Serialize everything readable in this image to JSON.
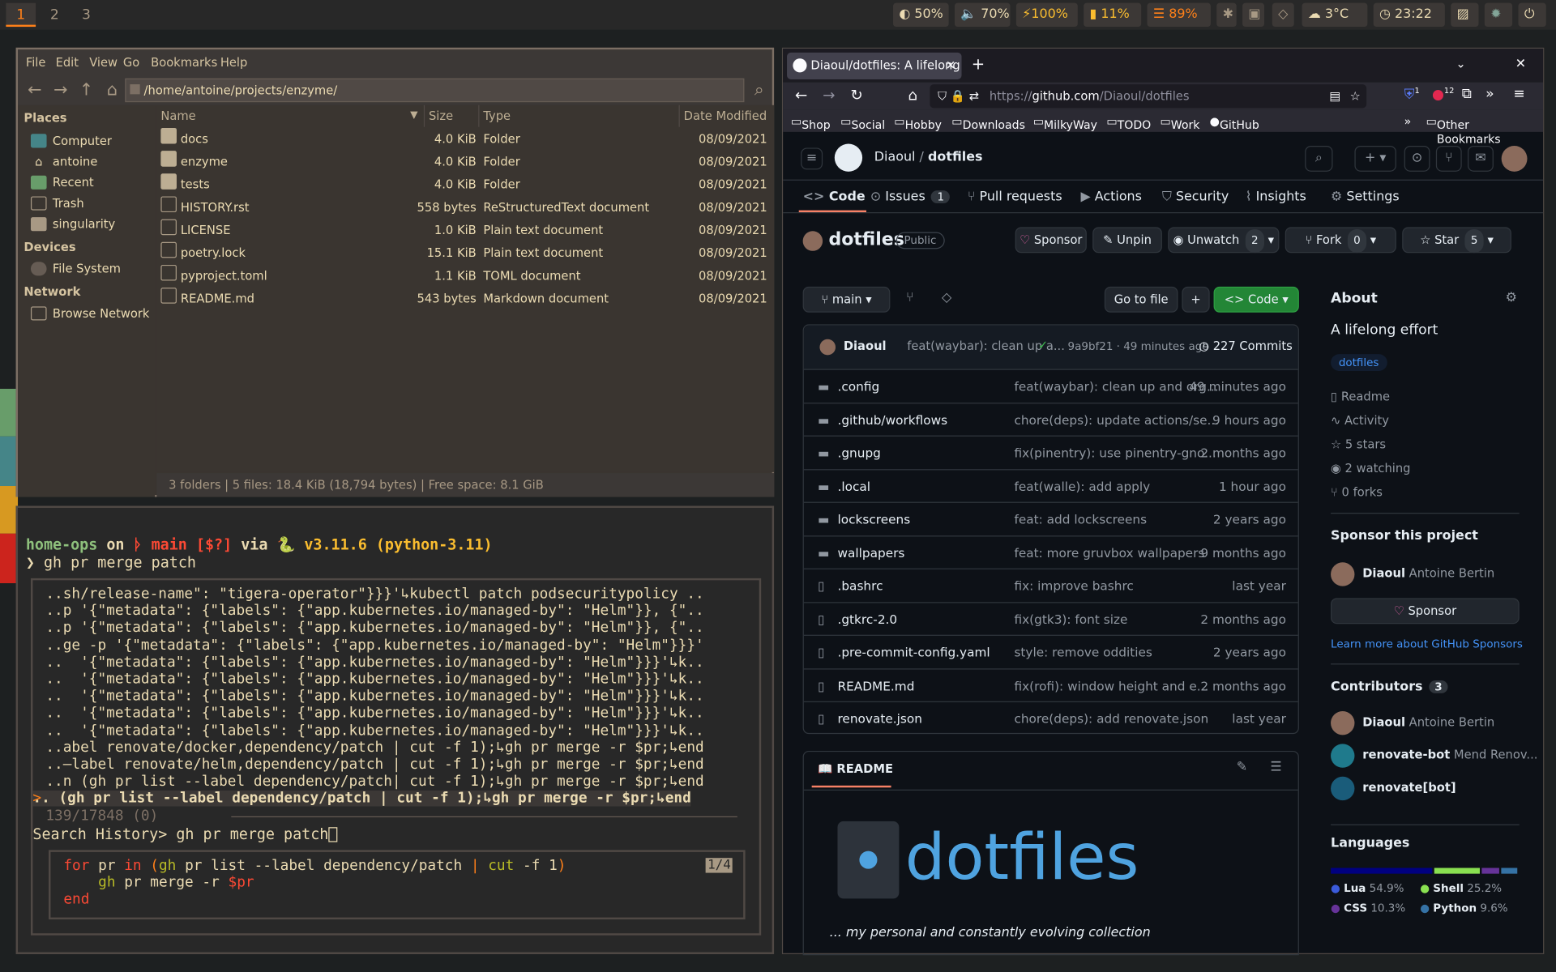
{
  "topbar": {
    "workspaces": [
      "1",
      "2",
      "3"
    ],
    "brightness": "◐ 50%",
    "volume": "🔈 70%",
    "power": "⚡100%",
    "battery": "▮ 11%",
    "memory": "☰ 89%",
    "weather": "3°C",
    "clock": "◷ 23:22"
  },
  "fm": {
    "menu": [
      "File",
      "Edit",
      "View",
      "Go",
      "Bookmarks",
      "Help"
    ],
    "path": "/home/antoine/projects/enzyme/",
    "places_header": "Places",
    "places": [
      "Computer",
      "antoine",
      "Recent",
      "Trash",
      "singularity"
    ],
    "devices_header": "Devices",
    "devices": [
      "File System"
    ],
    "network_header": "Network",
    "network": [
      "Browse Network"
    ],
    "columns": [
      "Name",
      "Size",
      "Type",
      "Date Modified"
    ],
    "rows": [
      {
        "name": "docs",
        "size": "4.0 KiB",
        "type": "Folder",
        "date": "08/09/2021"
      },
      {
        "name": "enzyme",
        "size": "4.0 KiB",
        "type": "Folder",
        "date": "08/09/2021"
      },
      {
        "name": "tests",
        "size": "4.0 KiB",
        "type": "Folder",
        "date": "08/09/2021"
      },
      {
        "name": "HISTORY.rst",
        "size": "558 bytes",
        "type": "ReStructuredText document",
        "date": "08/09/2021"
      },
      {
        "name": "LICENSE",
        "size": "1.0 KiB",
        "type": "Plain text document",
        "date": "08/09/2021"
      },
      {
        "name": "poetry.lock",
        "size": "15.1 KiB",
        "type": "Plain text document",
        "date": "08/09/2021"
      },
      {
        "name": "pyproject.toml",
        "size": "1.1 KiB",
        "type": "TOML document",
        "date": "08/09/2021"
      },
      {
        "name": "README.md",
        "size": "543 bytes",
        "type": "Markdown document",
        "date": "08/09/2021"
      }
    ],
    "status": "3 folders  |  5 files: 18.4 KiB (18,794 bytes)  |  Free space: 8.1 GiB"
  },
  "term": {
    "prompt_dir": "home-ops",
    "prompt_on": " on ",
    "prompt_branch": "ᚦ main [$?]",
    "prompt_via": " via ",
    "prompt_py": "🐍 v3.11.6 (python-3.11)",
    "command": "❯ gh pr merge patch",
    "history": [
      "..sh/release-name\": \"tigera-operator\"}}}'↳kubectl patch podsecuritypolicy ..",
      "..p '{\"metadata\": {\"labels\": {\"app.kubernetes.io/managed-by\": \"Helm\"}}, {\"..",
      "..p '{\"metadata\": {\"labels\": {\"app.kubernetes.io/managed-by\": \"Helm\"}}, {\"..",
      "..ge -p '{\"metadata\": {\"labels\": {\"app.kubernetes.io/managed-by\": \"Helm\"}}}'",
      "..  '{\"metadata\": {\"labels\": {\"app.kubernetes.io/managed-by\": \"Helm\"}}}'↳k..",
      "..  '{\"metadata\": {\"labels\": {\"app.kubernetes.io/managed-by\": \"Helm\"}}}'↳k..",
      "..  '{\"metadata\": {\"labels\": {\"app.kubernetes.io/managed-by\": \"Helm\"}}}'↳k..",
      "..  '{\"metadata\": {\"labels\": {\"app.kubernetes.io/managed-by\": \"Helm\"}}}'↳k..",
      "..  '{\"metadata\": {\"labels\": {\"app.kubernetes.io/managed-by\": \"Helm\"}}}'↳k..",
      "..abel renovate/docker,dependency/patch | cut -f 1);↳gh pr merge -r $pr;↳end",
      "..—label renovate/helm,dependency/patch | cut -f 1);↳gh pr merge -r $pr;↳end",
      "..n (gh pr list --label dependency/patch| cut -f 1);↳gh pr merge -r $pr;↳end",
      ".. (gh pr list --label dependency/patch | cut -f 1);↳gh pr merge -r $pr;↳end"
    ],
    "count": "139/17848 (0)",
    "search_label": "Search History> ",
    "search_query": "gh pr merge patch",
    "preview_lines": [
      "for pr in (gh pr list --label dependency/patch | cut -f 1)",
      "    gh pr merge -r $pr",
      "end"
    ],
    "preview_page": "1/4"
  },
  "browser": {
    "tab_title": "Diaoul/dotfiles: A lifelong e",
    "url_prefix": "https://",
    "url_host": "github.com",
    "url_path": "/Diaoul/dotfiles",
    "bookmarks": [
      "Shop",
      "Social",
      "Hobby",
      "Downloads",
      "MilkyWay",
      "TODO",
      "Work",
      "GitHub"
    ],
    "other_bookmarks": "Other Bookmarks",
    "badge1": "1",
    "badge2": "12"
  },
  "gh": {
    "owner": "Diaoul",
    "sep": "/",
    "repo": "dotfiles",
    "tabs": [
      {
        "label": "Code",
        "count": ""
      },
      {
        "label": "Issues",
        "count": "1"
      },
      {
        "label": "Pull requests",
        "count": ""
      },
      {
        "label": "Actions",
        "count": ""
      },
      {
        "label": "Security",
        "count": ""
      },
      {
        "label": "Insights",
        "count": ""
      },
      {
        "label": "Settings",
        "count": ""
      }
    ],
    "visibility": "Public",
    "sponsor": "Sponsor",
    "unpin": "Unpin",
    "unwatch": "Unwatch",
    "watch_count": "2",
    "fork": "Fork",
    "fork_count": "0",
    "star": "Star",
    "star_count": "5",
    "branch": "main",
    "go_to_file": "Go to file",
    "code_btn": "Code",
    "commit_author": "Diaoul",
    "commit_msg": "feat(waybar): clean up a...",
    "commit_hash": "9a9bf21 · 49 minutes ago",
    "commits": "227 Commits",
    "files": [
      {
        "name": ".config",
        "msg": "feat(waybar): clean up and org...",
        "age": "49 minutes ago",
        "dir": true
      },
      {
        "name": ".github/workflows",
        "msg": "chore(deps): update actions/se...",
        "age": "9 hours ago",
        "dir": true
      },
      {
        "name": ".gnupg",
        "msg": "fix(pinentry): use pinentry-gno...",
        "age": "2 months ago",
        "dir": true
      },
      {
        "name": ".local",
        "msg": "feat(walle): add apply",
        "age": "1 hour ago",
        "dir": true
      },
      {
        "name": "lockscreens",
        "msg": "feat: add lockscreens",
        "age": "2 years ago",
        "dir": true
      },
      {
        "name": "wallpapers",
        "msg": "feat: more gruvbox wallpapers",
        "age": "9 months ago",
        "dir": true
      },
      {
        "name": ".bashrc",
        "msg": "fix: improve bashrc",
        "age": "last year",
        "dir": false
      },
      {
        "name": ".gtkrc-2.0",
        "msg": "fix(gtk3): font size",
        "age": "2 months ago",
        "dir": false
      },
      {
        "name": ".pre-commit-config.yaml",
        "msg": "style: remove oddities",
        "age": "2 years ago",
        "dir": false
      },
      {
        "name": "README.md",
        "msg": "fix(rofi): window height and e...",
        "age": "2 months ago",
        "dir": false
      },
      {
        "name": "renovate.json",
        "msg": "chore(deps): add renovate.json",
        "age": "last year",
        "dir": false
      }
    ],
    "readme_tab": "README",
    "readme_logo": "dotfiles",
    "readme_tagline": "... my personal and constantly evolving collection",
    "about_title": "About",
    "about_desc": "A lifelong effort",
    "topic": "dotfiles",
    "about_links": [
      "Readme",
      "Activity",
      "5 stars",
      "2 watching",
      "0 forks"
    ],
    "sponsor_title": "Sponsor this project",
    "sponsor_user": "Diaoul",
    "sponsor_name": "Antoine Bertin",
    "sponsor_btn": "Sponsor",
    "sponsor_learn": "Learn more about GitHub Sponsors",
    "contributors_title": "Contributors",
    "contributors_count": "3",
    "contributors": [
      {
        "login": "Diaoul",
        "name": "Antoine Bertin"
      },
      {
        "login": "renovate-bot",
        "name": "Mend Renov..."
      },
      {
        "login": "renovate[bot]",
        "name": ""
      }
    ],
    "languages_title": "Languages",
    "languages": [
      {
        "name": "Lua",
        "pct": "54.9%",
        "value": 54.9,
        "color": "#000080"
      },
      {
        "name": "Shell",
        "pct": "25.2%",
        "value": 25.2,
        "color": "#89e051"
      },
      {
        "name": "CSS",
        "pct": "10.3%",
        "value": 10.3,
        "color": "#663399"
      },
      {
        "name": "Python",
        "pct": "9.6%",
        "value": 9.6,
        "color": "#3572A5"
      }
    ]
  }
}
